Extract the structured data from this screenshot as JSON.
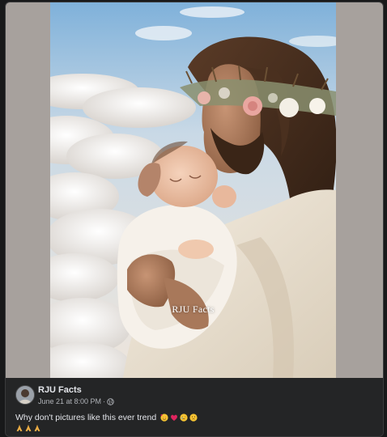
{
  "post": {
    "author": "RJU Facts",
    "date": "June 21 at 8:00 PM",
    "separator": "·",
    "privacy_icon": "globe-icon",
    "text": "Why don't pictures like this ever trend",
    "emojis_inline": [
      "smiling-face-with-hearts-icon",
      "red-heart-icon",
      "face-with-tears-icon",
      "sad-face-icon"
    ],
    "emojis_second_line": [
      "folded-hands-icon",
      "folded-hands-icon",
      "folded-hands-icon"
    ]
  },
  "image": {
    "watermark": "RJU Facts"
  },
  "colors": {
    "card_bg": "#242526",
    "primary_text": "#e4e6eb",
    "secondary_text": "#b0b3b8",
    "frame_bg": "#a7a19d"
  }
}
